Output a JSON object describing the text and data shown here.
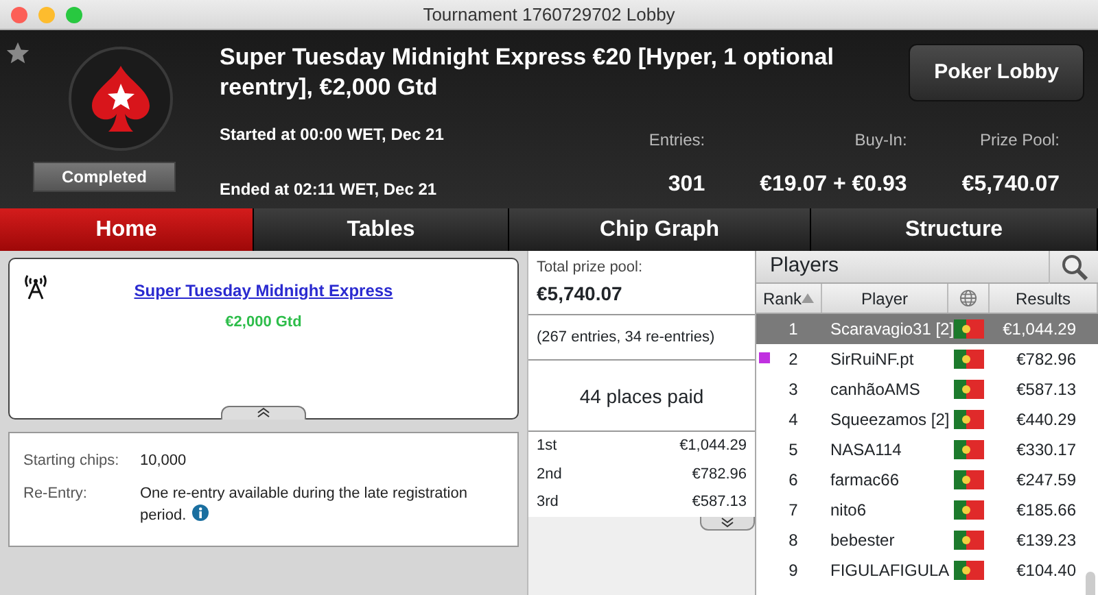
{
  "window": {
    "title": "Tournament 1760729702 Lobby"
  },
  "header": {
    "title": "Super Tuesday Midnight Express €20 [Hyper, 1 optional reentry], €2,000 Gtd",
    "status": "Completed",
    "started": "Started at 00:00 WET, Dec 21",
    "ended": "Ended at 02:11 WET, Dec 21",
    "lobby_button": "Poker Lobby",
    "stats": [
      {
        "label": "Entries:",
        "value": "301"
      },
      {
        "label": "Buy-In:",
        "value": "€19.07 + €0.93"
      },
      {
        "label": "Prize Pool:",
        "value": "€5,740.07"
      }
    ]
  },
  "tabs": [
    {
      "label": "Home",
      "selected": true
    },
    {
      "label": "Tables",
      "selected": false
    },
    {
      "label": "Chip Graph",
      "selected": false
    },
    {
      "label": "Structure",
      "selected": false
    }
  ],
  "banner": {
    "link": "Super Tuesday Midnight Express",
    "guarantee": "€2,000 Gtd"
  },
  "details": [
    {
      "label": "Starting chips:",
      "value": "10,000",
      "info": false
    },
    {
      "label": "Re-Entry:",
      "value": "One re-entry available during the late registration period.",
      "info": true
    }
  ],
  "prize": {
    "label": "Total prize pool:",
    "total": "€5,740.07",
    "entries": "(267 entries, 34 re-entries)",
    "places": "44 places paid",
    "payouts": [
      {
        "place": "1st",
        "amount": "€1,044.29"
      },
      {
        "place": "2nd",
        "amount": "€782.96"
      },
      {
        "place": "3rd",
        "amount": "€587.13"
      }
    ]
  },
  "players": {
    "title": "Players",
    "columns": [
      "Rank",
      "Player",
      "Results"
    ],
    "rows": [
      {
        "rank": "1",
        "name": "Scaravagio31 [2]",
        "result": "€1,044.29",
        "selected": true
      },
      {
        "rank": "2",
        "name": "SirRuiNF.pt",
        "result": "€782.96",
        "selected": false,
        "color": "#c030e0"
      },
      {
        "rank": "3",
        "name": "canhãoAMS",
        "result": "€587.13",
        "selected": false
      },
      {
        "rank": "4",
        "name": "Squeezamos [2]",
        "result": "€440.29",
        "selected": false
      },
      {
        "rank": "5",
        "name": "NASA114",
        "result": "€330.17",
        "selected": false
      },
      {
        "rank": "6",
        "name": "farmac66",
        "result": "€247.59",
        "selected": false
      },
      {
        "rank": "7",
        "name": "nito6",
        "result": "€185.66",
        "selected": false
      },
      {
        "rank": "8",
        "name": "bebester",
        "result": "€139.23",
        "selected": false
      },
      {
        "rank": "9",
        "name": "FIGULAFIGULA",
        "result": "€104.40",
        "selected": false
      }
    ]
  }
}
